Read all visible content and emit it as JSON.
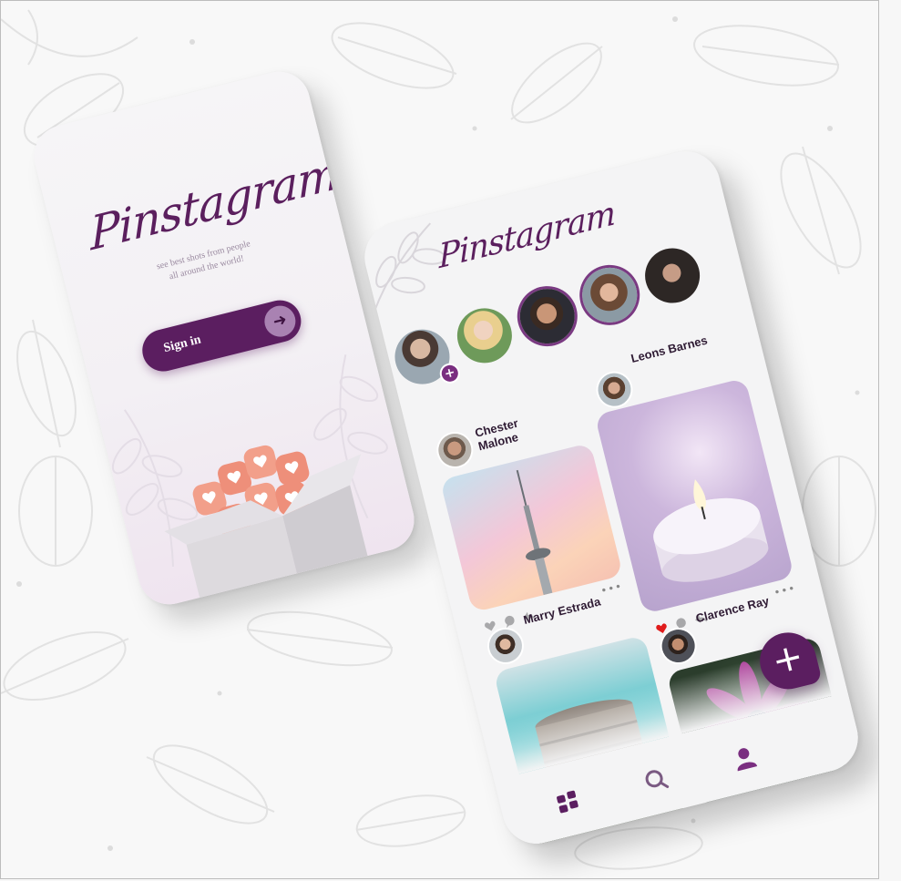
{
  "login_screen": {
    "logo": "Pinstagram",
    "tagline_line1": "see best shots from people",
    "tagline_line2": "all around the world!",
    "signin_label": "Sign in",
    "signin_icon": "arrow-right-icon"
  },
  "feed_screen": {
    "logo": "Pinstagram",
    "stories": [
      {
        "name": "you",
        "has_add": true
      },
      {
        "name": "story-2"
      },
      {
        "name": "story-3"
      },
      {
        "name": "story-4"
      },
      {
        "name": "story-5"
      }
    ],
    "posts": [
      {
        "author": "Chester Malone",
        "image": "tower"
      },
      {
        "author": "Leons Barnes",
        "image": "candle"
      },
      {
        "author": "Marry Estrada",
        "image": "building"
      },
      {
        "author": "Clarence Ray",
        "image": "flower"
      }
    ],
    "more_label": "•••",
    "fab_label": "+",
    "nav": [
      "grid-icon",
      "search-icon",
      "profile-icon"
    ]
  },
  "colors": {
    "brand": "#5b1e60",
    "accent": "#a982b2",
    "like_active": "#e01b1b"
  }
}
